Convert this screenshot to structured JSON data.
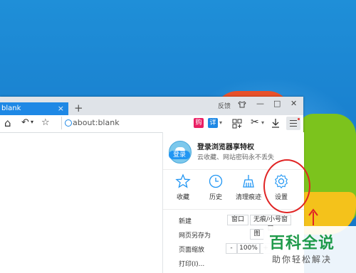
{
  "browser": {
    "tab_title": "blank",
    "tab_close": "×",
    "new_tab": "+",
    "feedback": "反馈",
    "controls": {
      "minimize": "—",
      "maximize": "□",
      "close": "✕"
    },
    "toolbar": {
      "home": "⌂",
      "undo": "↶",
      "undo_arrow": "▾",
      "star": "☆",
      "address": "about:blank"
    },
    "badges": [
      {
        "label": "购",
        "color": "#e91e63"
      },
      {
        "label": "详",
        "color": "#1e88e5"
      }
    ],
    "accent": "#1e88e5"
  },
  "menu": {
    "login_button": "登录",
    "login_title": "登录浏览器享特权",
    "login_subtitle": "云收藏、网站密码永不丢失",
    "quick_actions": [
      {
        "label": "收藏",
        "icon": "star-icon"
      },
      {
        "label": "历史",
        "icon": "clock-icon"
      },
      {
        "label": "清理痕迹",
        "icon": "broom-icon"
      },
      {
        "label": "设置",
        "icon": "gear-icon"
      }
    ],
    "rows": {
      "new_label": "新建",
      "new_window": "窗口",
      "new_incognito": "无痕/小号窗口",
      "saveas_label": "网页另存为",
      "saveas_button": "图",
      "zoom_label": "页面缩放",
      "zoom_minus": "-",
      "zoom_value": "100%",
      "zoom_plus": "+",
      "print_label": "打印(I)..."
    }
  },
  "watermark": {
    "main": "百科全说",
    "sub": "助你轻松解决"
  },
  "annotation_color": "#e02424"
}
